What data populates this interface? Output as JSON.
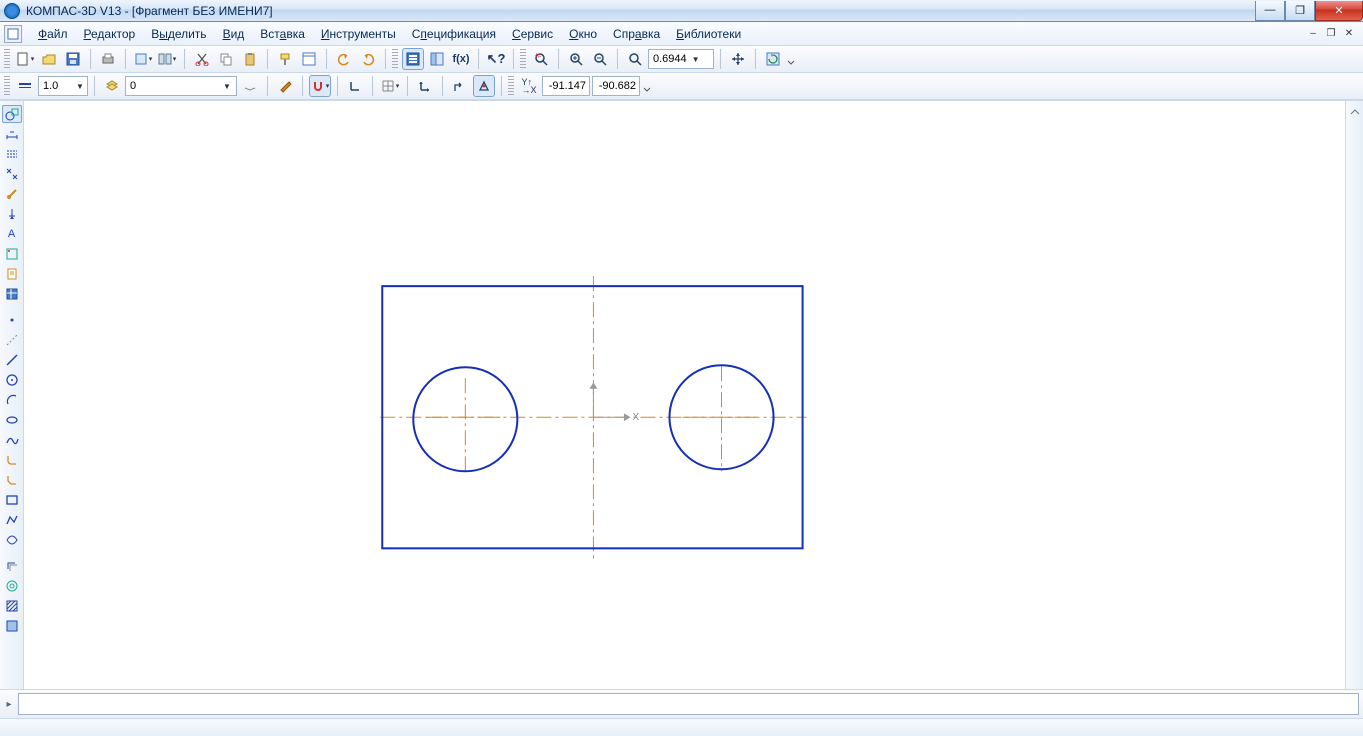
{
  "title": {
    "app": "КОМПАС-3D V13",
    "doc": "[Фрагмент БЕЗ ИМЕНИ7]"
  },
  "menu": {
    "file": "Файл",
    "editor": "Редактор",
    "select": "Выделить",
    "view": "Вид",
    "insert": "Вставка",
    "tools": "Инструменты",
    "spec": "Спецификация",
    "service": "Сервис",
    "window": "Окно",
    "help": "Справка",
    "libraries": "Библиотеки"
  },
  "toolbar1": {
    "zoom_value": "0.6944"
  },
  "toolbar2": {
    "line_width": "1.0",
    "layer": "0",
    "coord_x": "-91.147",
    "coord_y": "-90.682"
  },
  "canvas_axes": {
    "x_label": "X"
  }
}
